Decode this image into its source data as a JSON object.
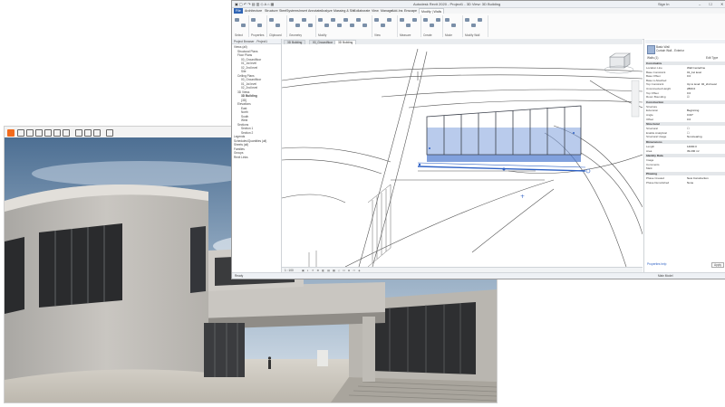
{
  "render_window": {
    "toolbar_icons": [
      "enscape-logo-icon",
      "sync-icon",
      "cube-icon",
      "view-icon",
      "camera-icon",
      "settings-icon",
      "visual-settings-icon",
      "screenshot-icon",
      "video-icon",
      "asset-library-icon",
      "views-icon"
    ]
  },
  "revit": {
    "title_bar": {
      "title": "Autodesk Revit 2020 - Project1 - 3D View: 3D Building",
      "user": "Sign In"
    },
    "ribbon_tabs": [
      "File",
      "Architecture",
      "Structure",
      "Steel",
      "Systems",
      "Insert",
      "Annotate",
      "Analyze",
      "Massing & Site",
      "Collaborate",
      "View",
      "Manage",
      "Add-Ins",
      "Enscape",
      "Modify | Walls"
    ],
    "active_tab": "Modify | Walls",
    "ribbon_groups": [
      "Select",
      "Properties",
      "Clipboard",
      "Geometry",
      "Modify",
      "View",
      "Measure",
      "Create",
      "Mode",
      "Modify Wall"
    ],
    "project_browser": {
      "title": "Project Browser - Project1",
      "items": [
        {
          "label": "Views (all)",
          "indent": 0
        },
        {
          "label": "Structural Plans",
          "indent": 1
        },
        {
          "label": "Floor Plans",
          "indent": 1
        },
        {
          "label": "00_Groundfloor",
          "indent": 2
        },
        {
          "label": "01_1st level",
          "indent": 2
        },
        {
          "label": "02_2nd level",
          "indent": 2
        },
        {
          "label": "Site",
          "indent": 2
        },
        {
          "label": "Ceiling Plans",
          "indent": 1
        },
        {
          "label": "00_Groundfloor",
          "indent": 2
        },
        {
          "label": "01_1st level",
          "indent": 2
        },
        {
          "label": "02_2nd level",
          "indent": 2
        },
        {
          "label": "3D Views",
          "indent": 1
        },
        {
          "label": "3D Building",
          "indent": 2,
          "bold": true
        },
        {
          "label": "{3D}",
          "indent": 2
        },
        {
          "label": "Elevations",
          "indent": 1
        },
        {
          "label": "East",
          "indent": 2
        },
        {
          "label": "North",
          "indent": 2
        },
        {
          "label": "South",
          "indent": 2
        },
        {
          "label": "West",
          "indent": 2
        },
        {
          "label": "Sections",
          "indent": 1
        },
        {
          "label": "Section 1",
          "indent": 2
        },
        {
          "label": "Section 2",
          "indent": 2
        },
        {
          "label": "Legends",
          "indent": 0
        },
        {
          "label": "Schedules/Quantities (all)",
          "indent": 0
        },
        {
          "label": "Sheets (all)",
          "indent": 0
        },
        {
          "label": "Families",
          "indent": 0
        },
        {
          "label": "Groups",
          "indent": 0
        },
        {
          "label": "Revit Links",
          "indent": 0
        }
      ]
    },
    "view_tabs": [
      "3D Building",
      "00_Groundfloor",
      "3D Building"
    ],
    "active_view_tab": 2,
    "view_bar": {
      "scale": "1 : 100"
    },
    "status_bar": {
      "left": "Ready",
      "right": "Main Model"
    },
    "properties": {
      "type_name": "Basic Wall",
      "type_sub": "Curtain Wall - Exterior",
      "selector": "Walls (1)",
      "edit_type": "Edit Type",
      "sections": [
        {
          "title": "Constraints",
          "rows": [
            [
              "Location Line",
              "Wall Centerline"
            ],
            [
              "Base Constraint",
              "01_1st level"
            ],
            [
              "Base Offset",
              "0.0"
            ],
            [
              "Base is Attached",
              ""
            ],
            [
              "Top Constraint",
              "Up to level: 02_2nd level"
            ],
            [
              "Unconnected Height",
              "2800.0"
            ],
            [
              "Top Offset",
              "0.0"
            ],
            [
              "Room Bounding",
              "☑"
            ]
          ]
        },
        {
          "title": "Construction",
          "rows": [
            [
              "Structure",
              ""
            ],
            [
              "Extension",
              "Beginning"
            ],
            [
              "Angle",
              "0.00°"
            ],
            [
              "Offset",
              "0.0"
            ]
          ]
        },
        {
          "title": "Structural",
          "rows": [
            [
              "Structural",
              "☐"
            ],
            [
              "Enable Analytical",
              "☐"
            ],
            [
              "Structural Usage",
              "Non-bearing"
            ]
          ]
        },
        {
          "title": "Dimensions",
          "rows": [
            [
              "Length",
              "14000.0"
            ],
            [
              "Area",
              "39.200 m²"
            ]
          ]
        },
        {
          "title": "Identity Data",
          "rows": [
            [
              "Image",
              ""
            ],
            [
              "Comments",
              ""
            ],
            [
              "Mark",
              ""
            ]
          ]
        },
        {
          "title": "Phasing",
          "rows": [
            [
              "Phase Created",
              "New Construction"
            ],
            [
              "Phase Demolished",
              "None"
            ]
          ]
        }
      ],
      "help_link": "Properties help",
      "apply": "Apply"
    }
  }
}
